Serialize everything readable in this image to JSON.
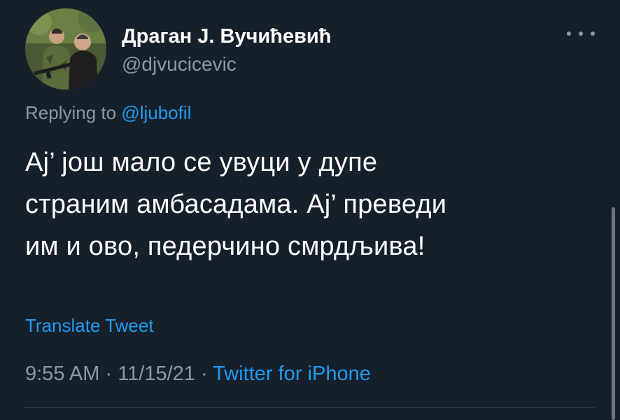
{
  "author": {
    "display_name": "Драган Ј. Вучићевић",
    "handle": "@djvucicevic",
    "avatar_icon": "profile-photo"
  },
  "more_icon": "more-horizontal-icon",
  "reply": {
    "prefix": "Replying to ",
    "mention": "@ljubofil"
  },
  "tweet": {
    "lines": [
      "Ај’ још мало се увуци у дупе",
      "страним амбасадама. Ај’ преведи",
      "им и ово, педерчино смрдљива!"
    ]
  },
  "translate_label": "Translate Tweet",
  "meta": {
    "time": "9:55 AM",
    "separator": " · ",
    "date": "11/15/21",
    "source": "Twitter for iPhone"
  },
  "colors": {
    "background": "#15202b",
    "accent": "#1d9bf0",
    "secondary_text": "#8b98a5"
  }
}
